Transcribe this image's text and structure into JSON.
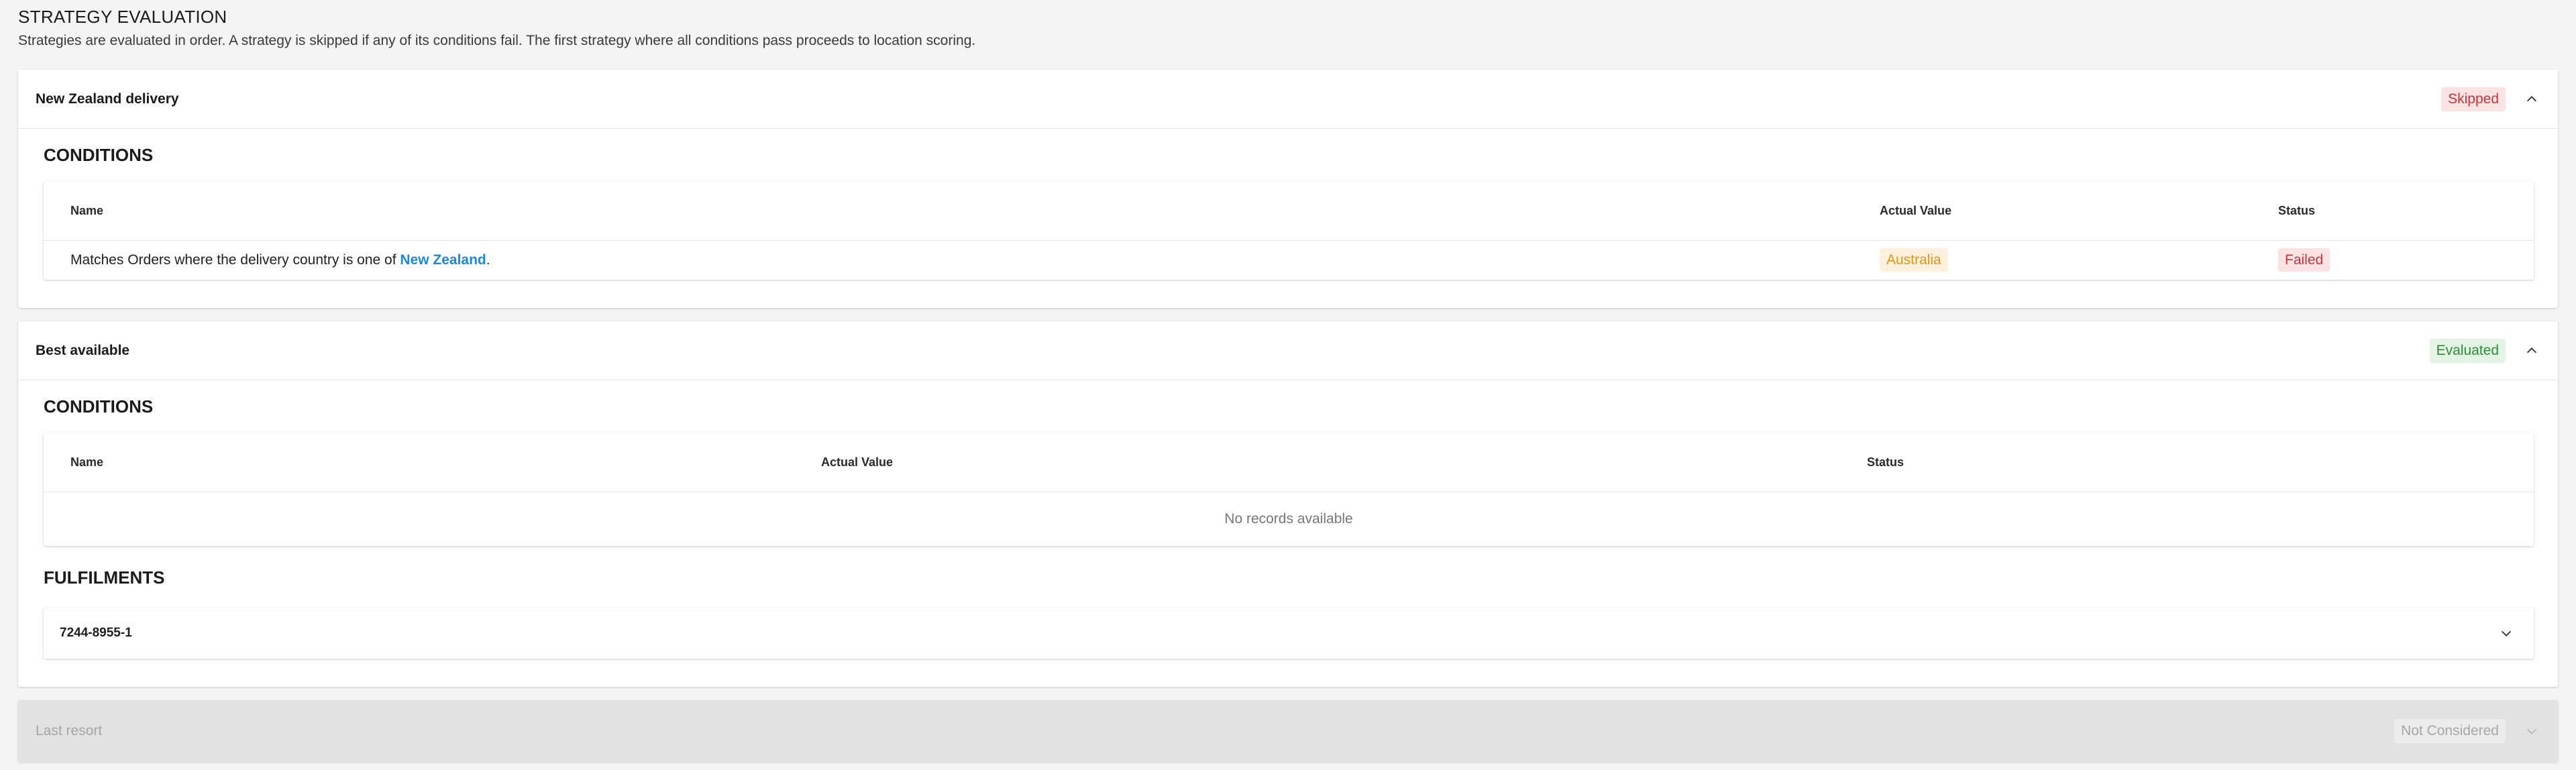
{
  "header": {
    "title": "STRATEGY EVALUATION",
    "description": "Strategies are evaluated in order. A strategy is skipped if any of its conditions fail. The first strategy where all conditions pass proceeds to location scoring."
  },
  "strategies": [
    {
      "name": "New Zealand delivery",
      "status": "Skipped",
      "conditions_title": "CONDITIONS",
      "columns": [
        "Name",
        "Actual Value",
        "Status"
      ],
      "rows": [
        {
          "name_prefix": "Matches Orders where the delivery country is one of ",
          "name_link": "New Zealand",
          "name_suffix": ".",
          "actual_value": "Australia",
          "status": "Failed"
        }
      ]
    },
    {
      "name": "Best available",
      "status": "Evaluated",
      "conditions_title": "CONDITIONS",
      "columns": [
        "Name",
        "Actual Value",
        "Status"
      ],
      "empty_text": "No records available",
      "fulfilments_title": "FULFILMENTS",
      "fulfilments": [
        "7244-8955-1"
      ]
    },
    {
      "name": "Last resort",
      "status": "Not Considered"
    }
  ],
  "colors": {
    "skipped": "#c8333b",
    "evaluated": "#2e8b3a",
    "warning": "#e59410",
    "link": "#1a8ad2"
  }
}
